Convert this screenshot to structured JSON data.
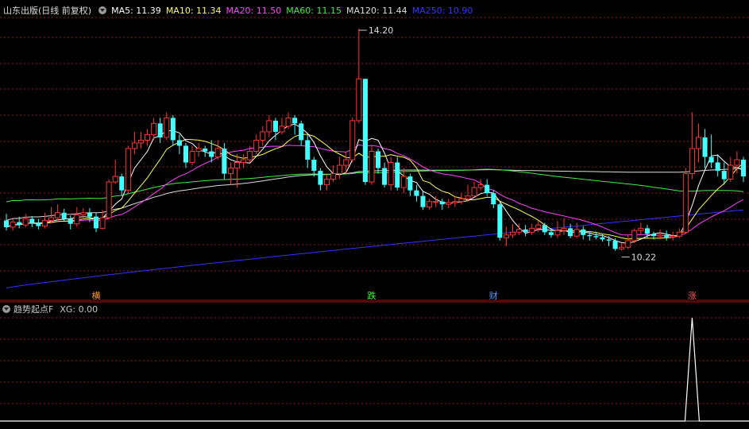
{
  "title": "山东出版(日线 前复权)",
  "ma_labels": [
    {
      "text": "MA5: 11.39",
      "color": "#ffffff"
    },
    {
      "text": "MA10: 11.34",
      "color": "#ffff55"
    },
    {
      "text": "MA20: 11.50",
      "color": "#ff44ff"
    },
    {
      "text": "MA60: 11.15",
      "color": "#44ee44"
    },
    {
      "text": "MA120: 11.44",
      "color": "#dddddd"
    },
    {
      "text": "MA250: 10.90",
      "color": "#3333ff"
    }
  ],
  "sub_title": "趋势起点F",
  "sub_value": "XG: 0.00",
  "signals": [
    {
      "text": "横",
      "index": 14,
      "color": "#ff9933"
    },
    {
      "text": "跌",
      "index": 57,
      "color": "#33ff33"
    },
    {
      "text": "财",
      "index": 76,
      "color": "#5599ff"
    },
    {
      "text": "涨",
      "index": 107,
      "color": "#ff5555"
    }
  ],
  "colors": {
    "up": "#ff3333",
    "down": "#44ffff",
    "grid": "#8a1a1a",
    "axis": "#aa1111"
  },
  "chart_data": {
    "type": "candlestick",
    "price_range": [
      9.5,
      14.4
    ],
    "annotations": [
      {
        "text": "14.20",
        "index": 55,
        "price": 14.2
      },
      {
        "text": "10.22",
        "index": 96,
        "price": 10.22
      }
    ],
    "candles": [
      [
        10.76,
        10.64,
        10.88,
        10.58
      ],
      [
        10.64,
        10.73,
        10.79,
        10.58
      ],
      [
        10.73,
        10.68,
        10.83,
        10.62
      ],
      [
        10.68,
        10.79,
        10.88,
        10.64
      ],
      [
        10.79,
        10.72,
        10.84,
        10.64
      ],
      [
        10.72,
        10.66,
        10.79,
        10.6
      ],
      [
        10.66,
        10.76,
        10.9,
        10.62
      ],
      [
        10.76,
        10.81,
        11.0,
        10.72
      ],
      [
        10.81,
        10.9,
        11.05,
        10.74
      ],
      [
        10.9,
        10.79,
        10.97,
        10.74
      ],
      [
        10.79,
        10.7,
        10.85,
        10.6
      ],
      [
        10.7,
        10.86,
        11.0,
        10.65
      ],
      [
        10.86,
        10.9,
        10.98,
        10.78
      ],
      [
        10.9,
        10.83,
        10.98,
        10.73
      ],
      [
        10.83,
        10.62,
        10.9,
        10.55
      ],
      [
        10.62,
        10.81,
        10.95,
        10.6
      ],
      [
        10.81,
        11.45,
        11.5,
        10.78
      ],
      [
        11.45,
        11.55,
        11.85,
        11.42
      ],
      [
        11.55,
        11.3,
        11.6,
        11.2
      ],
      [
        11.3,
        12.05,
        12.1,
        11.25
      ],
      [
        12.05,
        12.15,
        12.35,
        11.95
      ],
      [
        12.15,
        12.2,
        12.35,
        12.05
      ],
      [
        12.2,
        12.3,
        12.4,
        12.1
      ],
      [
        12.3,
        12.5,
        12.6,
        12.2
      ],
      [
        12.5,
        12.25,
        12.6,
        12.15
      ],
      [
        12.25,
        12.6,
        12.7,
        12.2
      ],
      [
        12.6,
        12.2,
        12.65,
        12.1
      ],
      [
        12.2,
        12.1,
        12.3,
        11.95
      ],
      [
        12.1,
        11.8,
        12.15,
        11.7
      ],
      [
        11.8,
        12.0,
        12.1,
        11.75
      ],
      [
        12.0,
        12.05,
        12.15,
        11.9
      ],
      [
        12.05,
        12.0,
        12.1,
        11.9
      ],
      [
        12.0,
        11.9,
        12.2,
        11.8
      ],
      [
        11.9,
        12.05,
        12.2,
        11.85
      ],
      [
        12.05,
        11.6,
        12.15,
        11.5
      ],
      [
        11.6,
        11.7,
        11.8,
        11.4
      ],
      [
        11.7,
        11.8,
        11.95,
        11.35
      ],
      [
        11.8,
        11.85,
        11.95,
        11.7
      ],
      [
        11.85,
        12.0,
        12.1,
        11.8
      ],
      [
        12.0,
        12.2,
        12.3,
        11.95
      ],
      [
        12.2,
        12.35,
        12.45,
        12.1
      ],
      [
        12.35,
        12.55,
        12.65,
        12.25
      ],
      [
        12.55,
        12.35,
        12.6,
        12.2
      ],
      [
        12.35,
        12.45,
        12.6,
        12.3
      ],
      [
        12.45,
        12.6,
        12.7,
        12.4
      ],
      [
        12.6,
        12.5,
        12.65,
        12.3
      ],
      [
        12.5,
        12.2,
        12.55,
        12.1
      ],
      [
        12.2,
        11.85,
        12.3,
        11.7
      ],
      [
        11.85,
        11.65,
        11.9,
        11.55
      ],
      [
        11.65,
        11.4,
        11.7,
        11.3
      ],
      [
        11.4,
        11.5,
        11.6,
        11.3
      ],
      [
        11.5,
        11.6,
        11.75,
        11.45
      ],
      [
        11.6,
        11.75,
        11.9,
        11.5
      ],
      [
        11.75,
        11.85,
        12.0,
        11.6
      ],
      [
        11.85,
        12.55,
        12.6,
        11.8
      ],
      [
        12.55,
        13.3,
        14.2,
        12.5
      ],
      [
        13.3,
        11.45,
        13.3,
        11.4
      ],
      [
        11.45,
        12.0,
        12.1,
        11.4
      ],
      [
        12.0,
        11.7,
        12.05,
        11.6
      ],
      [
        11.7,
        11.4,
        11.8,
        11.35
      ],
      [
        11.4,
        11.8,
        11.9,
        11.3
      ],
      [
        11.8,
        11.35,
        11.9,
        11.3
      ],
      [
        11.35,
        11.55,
        11.7,
        11.25
      ],
      [
        11.55,
        11.3,
        11.6,
        11.2
      ],
      [
        11.3,
        11.2,
        11.4,
        11.1
      ],
      [
        11.2,
        11.0,
        11.3,
        10.95
      ],
      [
        11.0,
        11.1,
        11.15,
        10.95
      ],
      [
        11.1,
        11.1,
        11.2,
        11.0
      ],
      [
        11.1,
        11.05,
        11.15,
        10.95
      ],
      [
        11.05,
        11.08,
        11.15,
        10.98
      ],
      [
        11.08,
        11.1,
        11.2,
        11.0
      ],
      [
        11.1,
        11.15,
        11.25,
        11.05
      ],
      [
        11.15,
        11.2,
        11.4,
        11.1
      ],
      [
        11.2,
        11.35,
        11.45,
        11.2
      ],
      [
        11.35,
        11.4,
        11.5,
        11.3
      ],
      [
        11.4,
        11.25,
        11.5,
        11.2
      ],
      [
        11.25,
        11.05,
        11.3,
        10.98
      ],
      [
        11.05,
        10.45,
        11.08,
        10.4
      ],
      [
        10.45,
        10.5,
        10.65,
        10.3
      ],
      [
        10.5,
        10.55,
        10.7,
        10.45
      ],
      [
        10.55,
        10.6,
        10.7,
        10.5
      ],
      [
        10.6,
        10.55,
        10.68,
        10.48
      ],
      [
        10.55,
        10.62,
        10.7,
        10.5
      ],
      [
        10.62,
        10.68,
        10.75,
        10.55
      ],
      [
        10.68,
        10.55,
        10.72,
        10.5
      ],
      [
        10.55,
        10.5,
        10.62,
        10.45
      ],
      [
        10.5,
        10.58,
        10.75,
        10.45
      ],
      [
        10.58,
        10.62,
        10.8,
        10.5
      ],
      [
        10.62,
        10.48,
        10.7,
        10.44
      ],
      [
        10.48,
        10.6,
        10.72,
        10.44
      ],
      [
        10.6,
        10.5,
        10.66,
        10.42
      ],
      [
        10.5,
        10.48,
        10.55,
        10.4
      ],
      [
        10.48,
        10.46,
        10.56,
        10.42
      ],
      [
        10.46,
        10.42,
        10.52,
        10.38
      ],
      [
        10.42,
        10.4,
        10.48,
        10.3
      ],
      [
        10.4,
        10.25,
        10.44,
        10.22
      ],
      [
        10.25,
        10.28,
        10.35,
        10.22
      ],
      [
        10.28,
        10.4,
        10.5,
        10.25
      ],
      [
        10.4,
        10.58,
        10.62,
        10.35
      ],
      [
        10.58,
        10.62,
        10.72,
        10.5
      ],
      [
        10.62,
        10.52,
        10.68,
        10.45
      ],
      [
        10.52,
        10.48,
        10.56,
        10.42
      ],
      [
        10.48,
        10.5,
        10.6,
        10.42
      ],
      [
        10.5,
        10.46,
        10.58,
        10.4
      ],
      [
        10.46,
        10.48,
        10.56,
        10.4
      ],
      [
        10.48,
        10.55,
        10.62,
        10.44
      ],
      [
        10.55,
        11.6,
        11.7,
        10.52
      ],
      [
        11.6,
        12.05,
        12.7,
        11.5
      ],
      [
        12.05,
        12.25,
        12.5,
        11.8
      ],
      [
        12.25,
        11.9,
        12.4,
        11.7
      ],
      [
        11.9,
        11.8,
        12.3,
        11.7
      ],
      [
        11.8,
        11.65,
        11.95,
        11.55
      ],
      [
        11.65,
        11.5,
        11.8,
        11.4
      ],
      [
        11.5,
        11.75,
        11.9,
        11.45
      ],
      [
        11.75,
        11.85,
        12.0,
        11.6
      ],
      [
        11.85,
        11.55,
        11.9,
        11.45
      ]
    ],
    "ma250_range": [
      9.55,
      10.95
    ],
    "xg_series_spike_index": 107
  }
}
